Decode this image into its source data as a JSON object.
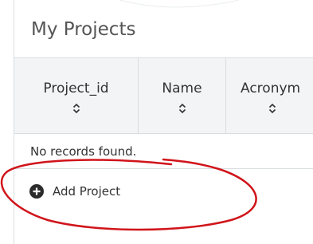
{
  "panel": {
    "title": "My Projects"
  },
  "table": {
    "columns": [
      {
        "label": "Project_id"
      },
      {
        "label": "Name"
      },
      {
        "label": "Acronym"
      }
    ],
    "empty_message": "No records found."
  },
  "actions": {
    "add_project_label": "Add Project"
  },
  "colors": {
    "annotation": "#d0141a",
    "border": "#d8dde1",
    "header_bg": "#f3f4f5",
    "text": "#333333"
  },
  "icons": {
    "sort": "sort-icon",
    "add": "plus-circle-icon"
  }
}
